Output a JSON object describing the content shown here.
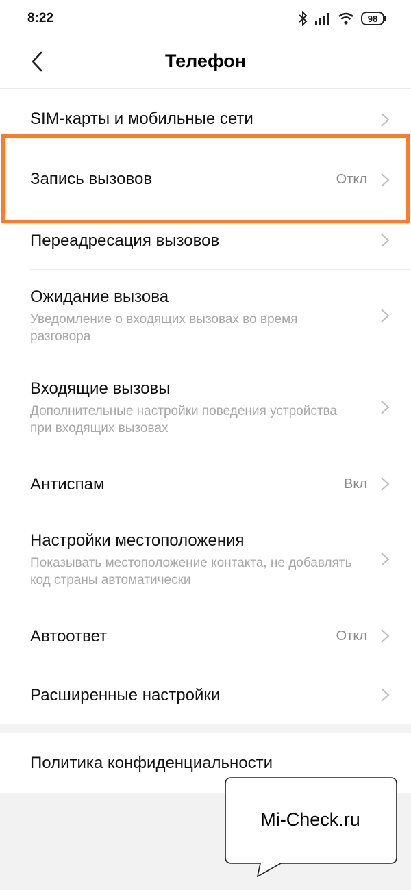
{
  "status_bar": {
    "time": "8:22",
    "battery": "98",
    "icons": [
      "bluetooth-icon",
      "signal-icon",
      "wifi-icon",
      "battery-icon"
    ]
  },
  "header": {
    "title": "Телефон",
    "back_icon": "chevron-left-icon"
  },
  "settings": [
    {
      "title": "SIM-карты и мобильные сети",
      "subtitle": "",
      "value": ""
    },
    {
      "title": "Запись вызовов",
      "subtitle": "",
      "value": "Откл"
    },
    {
      "title": "Переадресация вызовов",
      "subtitle": "",
      "value": ""
    },
    {
      "title": "Ожидание вызова",
      "subtitle": "Уведомление о входящих вызовах во время разговора",
      "value": ""
    },
    {
      "title": "Входящие вызовы",
      "subtitle": "Дополнительные настройки поведения устройства при входящих вызовах",
      "value": ""
    },
    {
      "title": "Антиспам",
      "subtitle": "",
      "value": "Вкл"
    },
    {
      "title": "Настройки местоположения",
      "subtitle": "Показывать местоположение контакта, не добавлять код страны автоматически",
      "value": ""
    },
    {
      "title": "Автоответ",
      "subtitle": "",
      "value": "Откл"
    },
    {
      "title": "Расширенные настройки",
      "subtitle": "",
      "value": ""
    }
  ],
  "policy": {
    "title": "Политика конфиденциальности"
  },
  "watermark": {
    "text": "Mi-Check.ru"
  },
  "colors": {
    "highlight": "#ff7a29",
    "secondary_text": "#a8a8a8",
    "value_text": "#8a8a8a",
    "divider": "#ececec"
  }
}
